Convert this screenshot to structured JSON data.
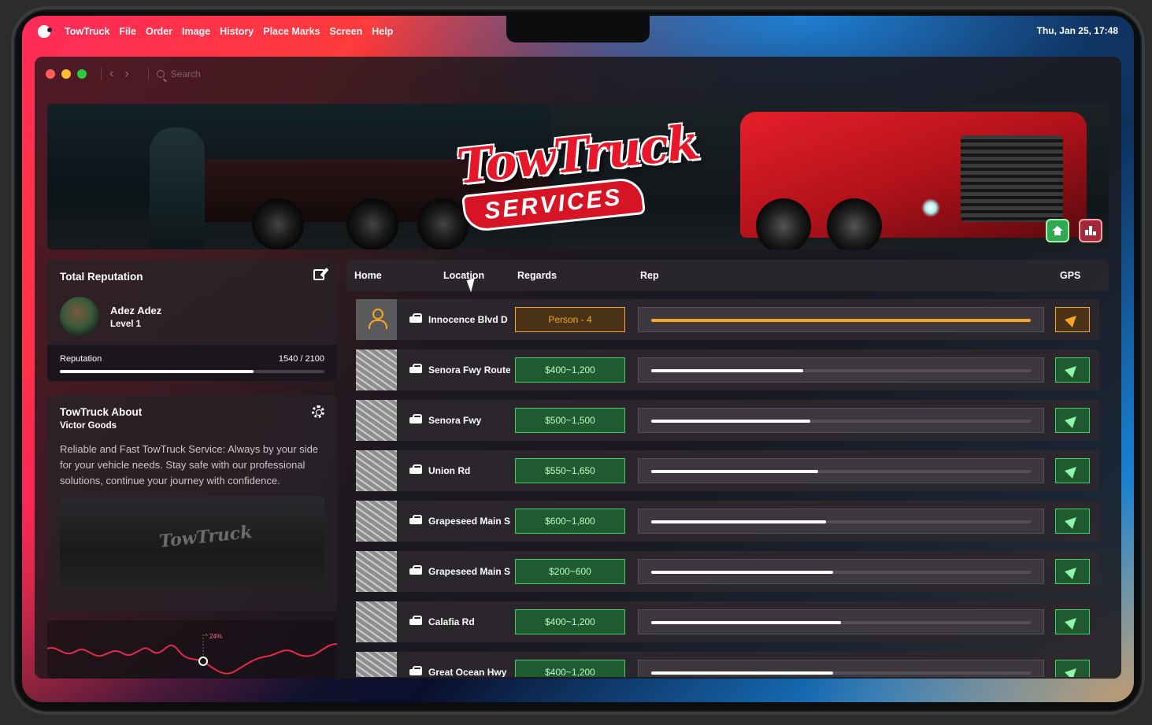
{
  "menubar": {
    "app_name": "TowTruck",
    "items": [
      "File",
      "Order",
      "Image",
      "History",
      "Place Marks",
      "Screen",
      "Help"
    ],
    "clock": "Thu, Jan 25, 17:48"
  },
  "window": {
    "search_placeholder": "Search"
  },
  "banner": {
    "logo_top": "TowTruck",
    "logo_bottom": "SERVICES"
  },
  "reputation": {
    "title": "Total Reputation",
    "name": "Adez Adez",
    "level": "Level 1",
    "label": "Reputation",
    "value_text": "1540 / 2100",
    "current": 1540,
    "max": 2100
  },
  "about": {
    "title": "TowTruck About",
    "subtitle": "Victor Goods",
    "description": "Reliable and Fast TowTruck Service: Always by your side for your vehicle needs. Stay safe with our professional solutions, continue your journey with confidence.",
    "image_logo": "TowTruck"
  },
  "trend": {
    "label": "^ 24%"
  },
  "table": {
    "headers": {
      "home": "Home",
      "location": "Location",
      "regards": "Regards",
      "rep": "Rep",
      "gps": "GPS"
    },
    "rows": [
      {
        "location": "Innocence Blvd D",
        "regards": "Person - 4",
        "rep": 1.0,
        "active": true
      },
      {
        "location": "Senora Fwy Route",
        "regards": "$400~1,200",
        "rep": 0.4,
        "active": false
      },
      {
        "location": "Senora Fwy",
        "regards": "$500~1,500",
        "rep": 0.42,
        "active": false
      },
      {
        "location": "Union Rd",
        "regards": "$550~1,650",
        "rep": 0.44,
        "active": false
      },
      {
        "location": "Grapeseed Main St",
        "regards": "$600~1,800",
        "rep": 0.46,
        "active": false
      },
      {
        "location": "Grapeseed Main St",
        "regards": "$200~600",
        "rep": 0.48,
        "active": false
      },
      {
        "location": "Calafia Rd",
        "regards": "$400~1,200",
        "rep": 0.5,
        "active": false
      },
      {
        "location": "Great Ocean Hwy",
        "regards": "$400~1,200",
        "rep": 0.48,
        "active": false
      }
    ]
  },
  "colors": {
    "accent_green": "#4ccb6b",
    "accent_orange": "#f5a623",
    "brand_red": "#e8172a"
  }
}
